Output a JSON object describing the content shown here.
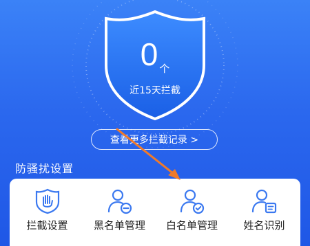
{
  "hero": {
    "count": "0",
    "count_unit": "个",
    "caption": "近15天拦截",
    "more_button": "查看更多拦截记录 >"
  },
  "section": {
    "title": "防骚扰设置"
  },
  "settings": [
    {
      "label": "拦截设置",
      "icon": "hand-shield-icon"
    },
    {
      "label": "黑名单管理",
      "icon": "user-minus-icon"
    },
    {
      "label": "白名单管理",
      "icon": "user-check-icon"
    },
    {
      "label": "姓名识别",
      "icon": "user-card-icon"
    }
  ],
  "colors": {
    "background": "#2b68ee",
    "shield": "#2d7bf5",
    "accent_icon": "#3a78f0",
    "annotation_arrow": "#f07a2a"
  }
}
